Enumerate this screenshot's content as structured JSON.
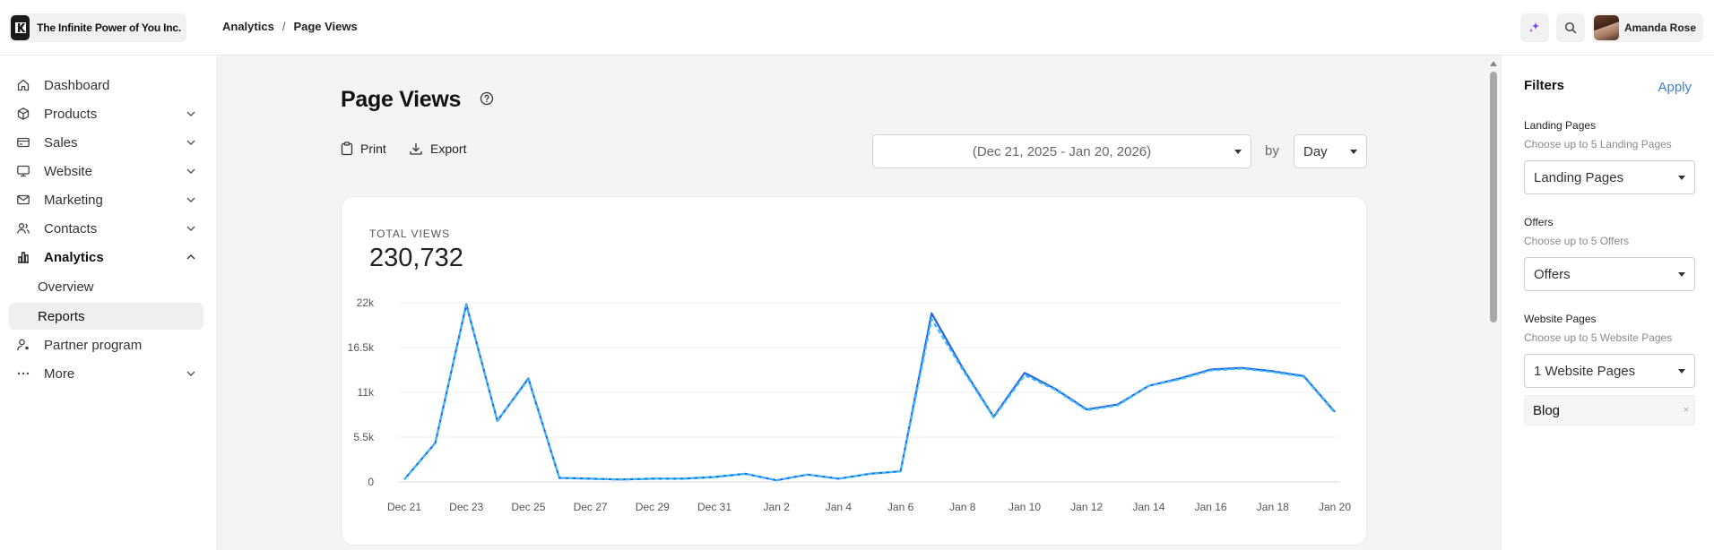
{
  "header": {
    "org_name": "The Infinite Power of You Inc.",
    "breadcrumb": [
      "Analytics",
      "Page Views"
    ],
    "breadcrumb_sep": "/",
    "user_name": "Amanda Rose"
  },
  "sidebar": {
    "items": [
      {
        "label": "Dashboard",
        "icon": "home-icon"
      },
      {
        "label": "Products",
        "icon": "box-icon"
      },
      {
        "label": "Sales",
        "icon": "card-icon"
      },
      {
        "label": "Website",
        "icon": "monitor-icon"
      },
      {
        "label": "Marketing",
        "icon": "mail-icon"
      },
      {
        "label": "Contacts",
        "icon": "users-icon"
      },
      {
        "label": "Analytics",
        "icon": "bar-chart-icon"
      },
      {
        "label": "Partner program",
        "icon": "partner-icon"
      },
      {
        "label": "More",
        "icon": "dots-icon"
      }
    ],
    "analytics_sub": [
      "Overview",
      "Reports"
    ]
  },
  "main": {
    "title": "Page Views",
    "print_label": "Print",
    "export_label": "Export",
    "date_range": "(Dec 21, 2025 - Jan 20, 2026)",
    "by_label": "by",
    "granularity": "Day",
    "total_label": "TOTAL VIEWS",
    "total_value": "230,732"
  },
  "filters": {
    "title": "Filters",
    "apply_label": "Apply",
    "groups": [
      {
        "label": "Landing Pages",
        "hint": "Choose up to 5 Landing Pages",
        "value": "Landing Pages"
      },
      {
        "label": "Offers",
        "hint": "Choose up to 5 Offers",
        "value": "Offers"
      },
      {
        "label": "Website Pages",
        "hint": "Choose up to 5 Website Pages",
        "value": "1 Website Pages"
      }
    ],
    "chip": "Blog",
    "chip_remove": "×"
  },
  "colors": {
    "line_primary": "#2563eb",
    "line_secondary": "#38bdf8",
    "apply": "#3b82d6"
  },
  "chart_data": {
    "type": "line",
    "ylim": [
      0,
      22000
    ],
    "yticks": [
      "0",
      "5.5k",
      "11k",
      "16.5k",
      "22k"
    ],
    "x": [
      "Dec 21",
      "Dec 22",
      "Dec 23",
      "Dec 24",
      "Dec 25",
      "Dec 26",
      "Dec 27",
      "Dec 28",
      "Dec 29",
      "Dec 30",
      "Dec 31",
      "Jan 1",
      "Jan 2",
      "Jan 3",
      "Jan 4",
      "Jan 5",
      "Jan 6",
      "Jan 7",
      "Jan 8",
      "Jan 9",
      "Jan 10",
      "Jan 11",
      "Jan 12",
      "Jan 13",
      "Jan 14",
      "Jan 15",
      "Jan 16",
      "Jan 17",
      "Jan 18",
      "Jan 19",
      "Jan 20"
    ],
    "xticks": [
      "Dec 21",
      "Dec 23",
      "Dec 25",
      "Dec 27",
      "Dec 29",
      "Dec 31",
      "Jan 2",
      "Jan 4",
      "Jan 6",
      "Jan 8",
      "Jan 10",
      "Jan 12",
      "Jan 14",
      "Jan 16",
      "Jan 18",
      "Jan 20"
    ],
    "series": [
      {
        "values": [
          300,
          4800,
          21800,
          7500,
          12700,
          500,
          400,
          300,
          400,
          400,
          600,
          1000,
          200,
          900,
          400,
          1000,
          1300,
          20700,
          14000,
          8000,
          13400,
          11400,
          8900,
          9500,
          11800,
          12700,
          13800,
          14000,
          13600,
          13000,
          8600
        ]
      },
      {
        "values": [
          300,
          4800,
          21700,
          7500,
          12600,
          500,
          400,
          300,
          400,
          400,
          600,
          1000,
          200,
          900,
          400,
          1000,
          1300,
          20000,
          13800,
          7900,
          13100,
          11300,
          8800,
          9400,
          11800,
          12600,
          13700,
          13900,
          13500,
          12900,
          8500
        ]
      }
    ]
  }
}
